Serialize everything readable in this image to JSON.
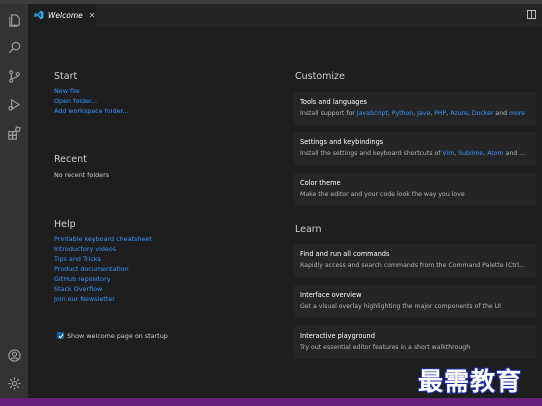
{
  "tab": {
    "label": "Welcome",
    "close": "✕"
  },
  "start": {
    "title": "Start",
    "links": [
      "New file",
      "Open folder...",
      "Add workspace folder..."
    ]
  },
  "recent": {
    "title": "Recent",
    "empty": "No recent folders"
  },
  "help": {
    "title": "Help",
    "links": [
      "Printable keyboard cheatsheet",
      "Introductory videos",
      "Tips and Tricks",
      "Product documentation",
      "GitHub repository",
      "Stack Overflow",
      "Join our Newsletter"
    ]
  },
  "startup_checkbox": {
    "label": "Show welcome page on startup",
    "checked": true
  },
  "customize": {
    "title": "Customize",
    "cards": [
      {
        "title": "Tools and languages",
        "desc_prefix": "Install support for ",
        "desc_links": [
          "JavaScript",
          "Python",
          "Java",
          "PHP",
          "Azure",
          "Docker"
        ],
        "desc_and": " and ",
        "desc_more": "more"
      },
      {
        "title": "Settings and keybindings",
        "desc_prefix": "Install the settings and keyboard shortcuts of ",
        "desc_links": [
          "Vim",
          "Sublime",
          "Atom"
        ],
        "desc_and": " and ..."
      },
      {
        "title": "Color theme",
        "desc": "Make the editor and your code look the way you love"
      }
    ]
  },
  "learn": {
    "title": "Learn",
    "cards": [
      {
        "title": "Find and run all commands",
        "desc": "Rapidly access and search commands from the Command Palette (Ctrl..."
      },
      {
        "title": "Interface overview",
        "desc": "Get a visual overlay highlighting the major components of the UI"
      },
      {
        "title": "Interactive playground",
        "desc": "Try out essential editor features in a short walkthrough"
      }
    ]
  },
  "watermark": "最需教育",
  "activity_icons": [
    "files-icon",
    "search-icon",
    "source-control-icon",
    "run-debug-icon",
    "extensions-icon",
    "account-icon",
    "settings-gear-icon"
  ],
  "colors": {
    "accent": "#3794ff",
    "status_bar": "#68217a",
    "background": "#1e1e1e"
  }
}
